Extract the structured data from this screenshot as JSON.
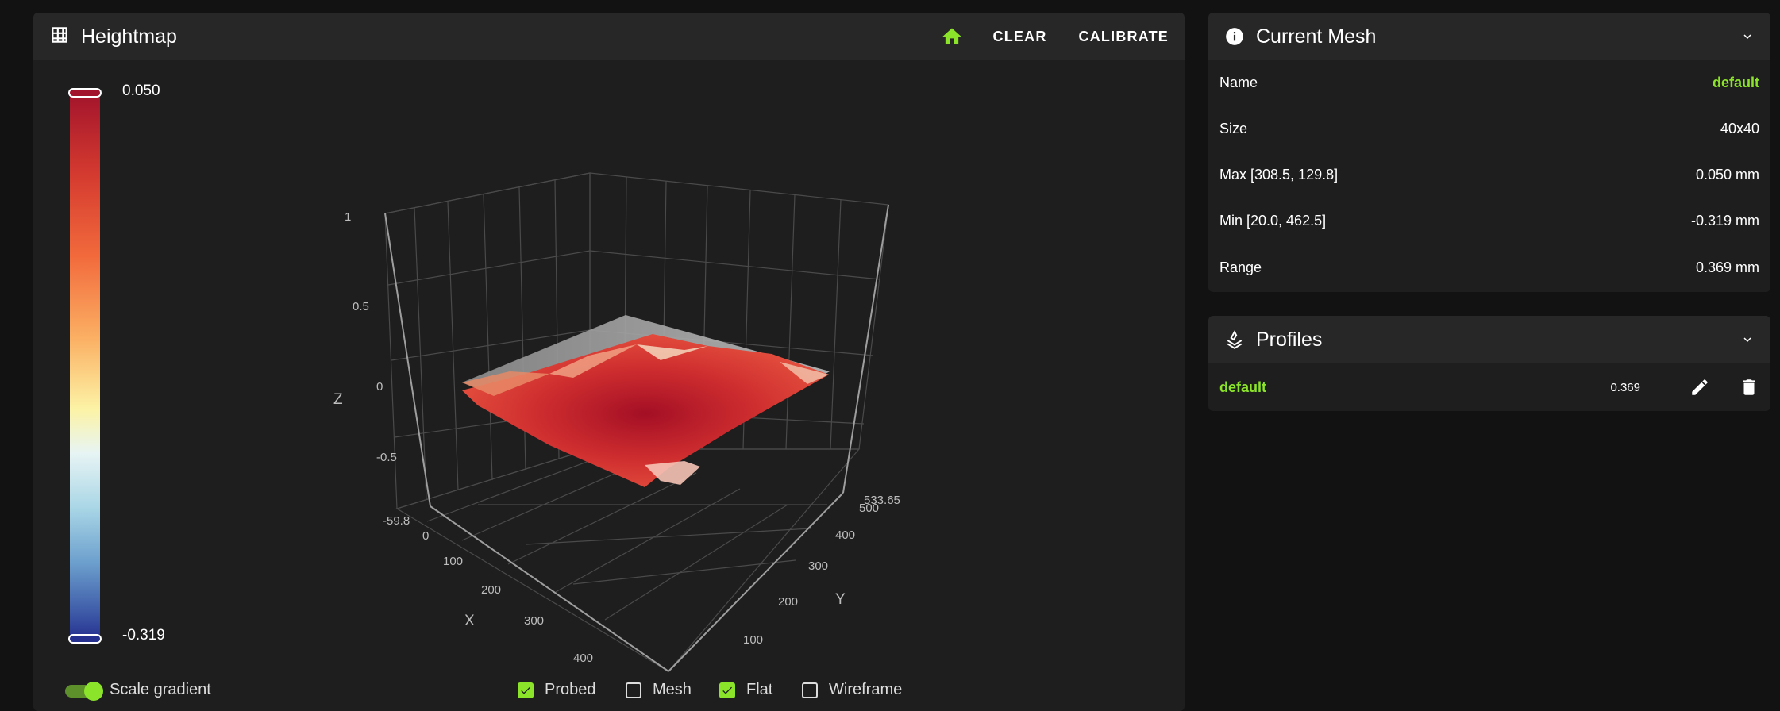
{
  "heightmap": {
    "title": "Heightmap",
    "clear_label": "CLEAR",
    "calibrate_label": "CALIBRATE",
    "scale_max": "0.050",
    "scale_min": "-0.319",
    "scale_gradient_label": "Scale gradient",
    "probed_label": "Probed",
    "mesh_label": "Mesh",
    "flat_label": "Flat",
    "wireframe_label": "Wireframe",
    "options": {
      "scale_gradient": true,
      "probed": true,
      "mesh": false,
      "flat": true,
      "wireframe": false
    },
    "plot": {
      "z_axis_label": "Z",
      "x_axis_label": "X",
      "y_axis_label": "Y",
      "z_ticks": [
        "1",
        "0.5",
        "0",
        "-0.5",
        "-59.8"
      ],
      "x_ticks": [
        "0",
        "100",
        "200",
        "300",
        "400"
      ],
      "y_ticks": [
        "100",
        "200",
        "300",
        "400",
        "500",
        "533.65"
      ]
    }
  },
  "current_mesh": {
    "title": "Current Mesh",
    "rows": [
      {
        "label": "Name",
        "value": "default"
      },
      {
        "label": "Size",
        "value": "40x40"
      },
      {
        "label": "Max [308.5, 129.8]",
        "value": "0.050 mm"
      },
      {
        "label": "Min [20.0, 462.5]",
        "value": "-0.319 mm"
      },
      {
        "label": "Range",
        "value": "0.369 mm"
      }
    ]
  },
  "profiles": {
    "title": "Profiles",
    "items": [
      {
        "name": "default",
        "range": "0.369"
      }
    ]
  },
  "colors": {
    "accent": "#8be42a",
    "surface": "#1e1e1e",
    "header": "#272727",
    "background": "#121212"
  },
  "icons": [
    "grid-icon",
    "home-icon",
    "info-icon",
    "chevron-down-icon",
    "layers-icon",
    "pencil-icon",
    "trash-icon"
  ]
}
